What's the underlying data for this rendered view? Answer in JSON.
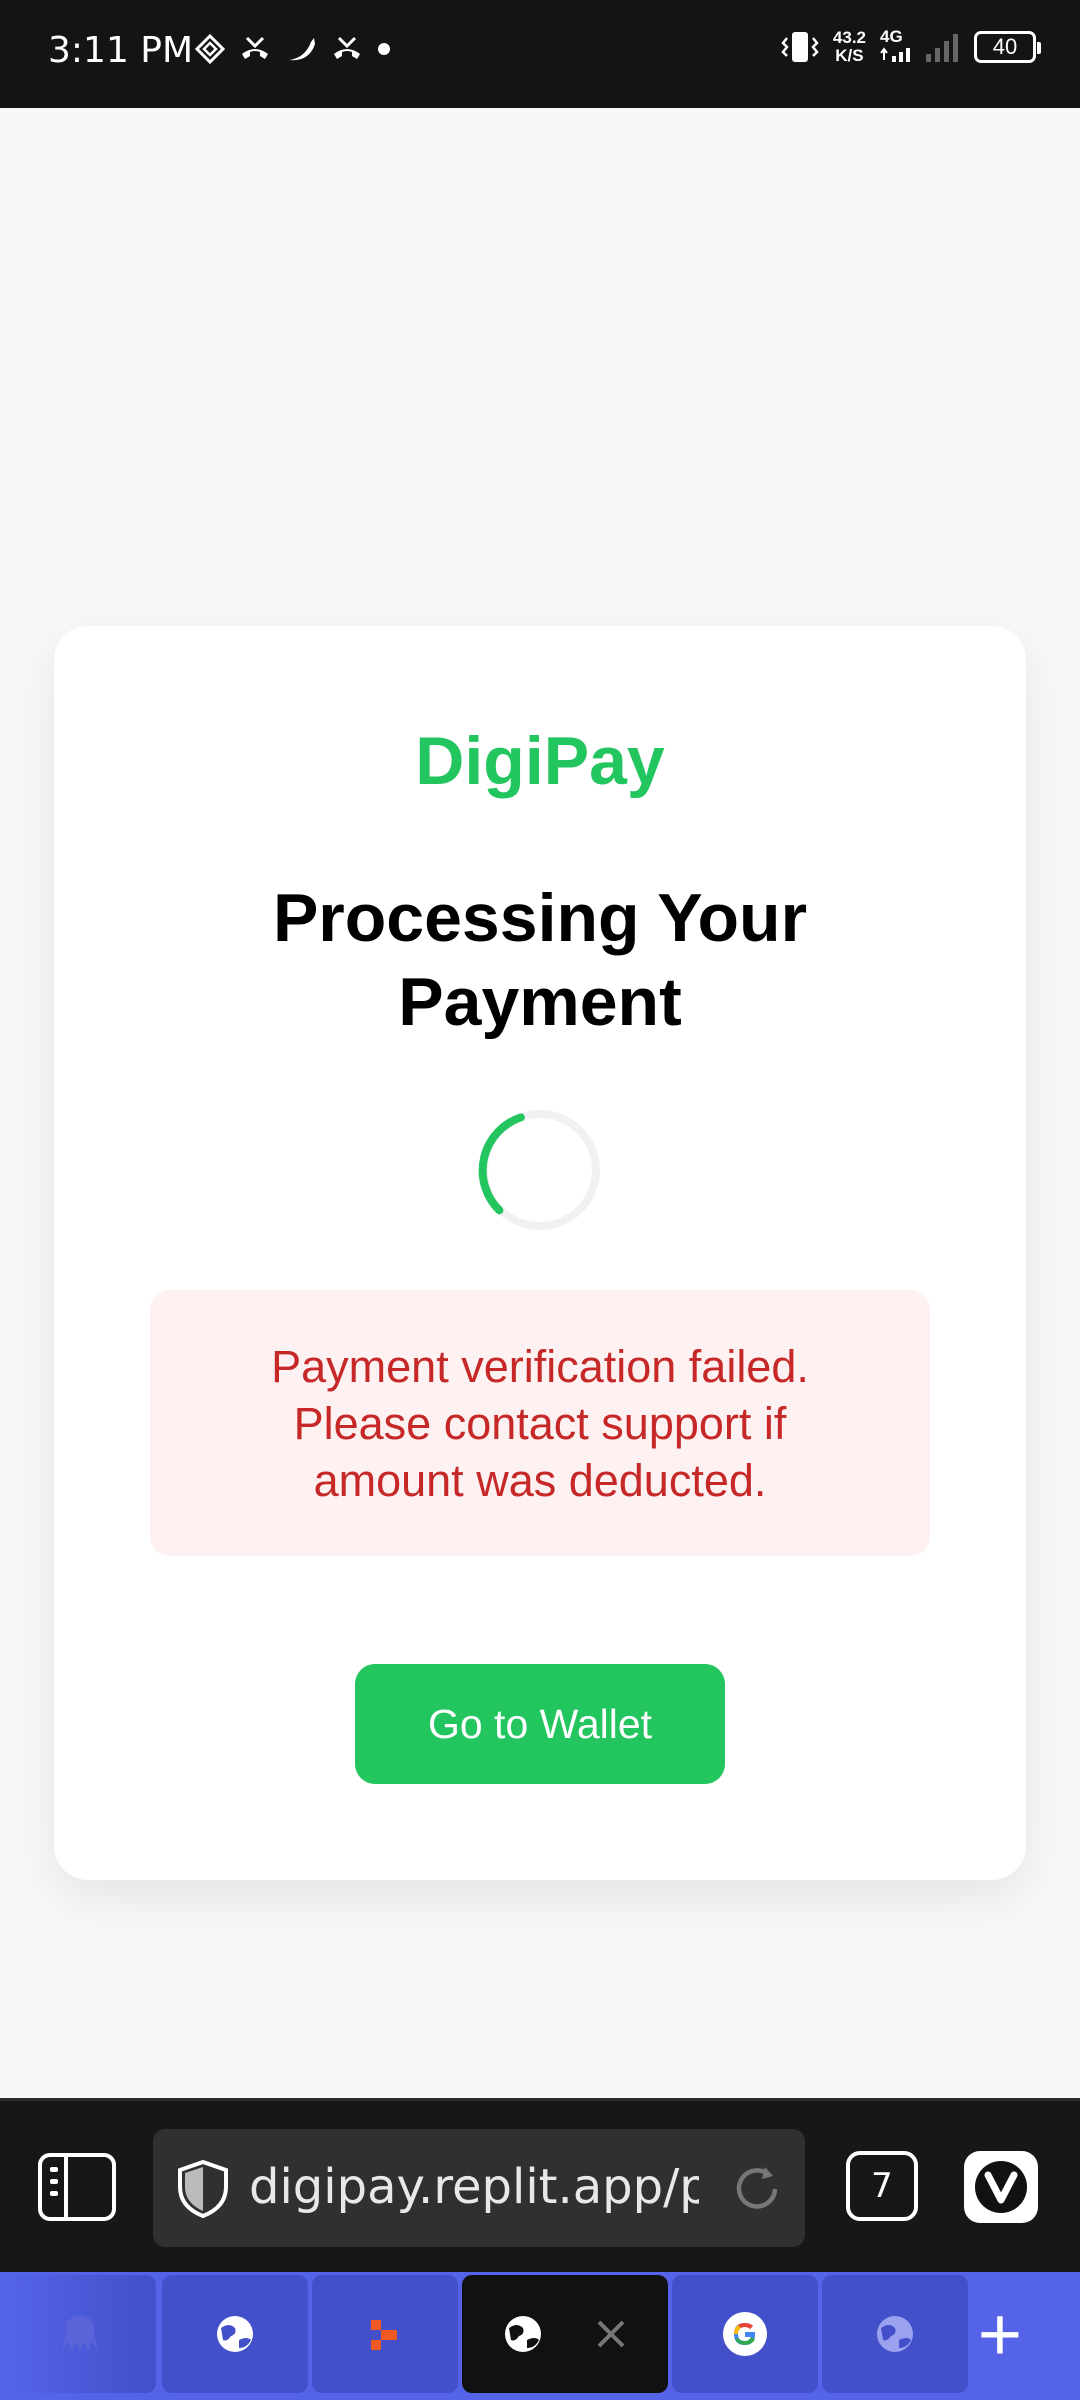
{
  "status_bar": {
    "time": "3:11 PM",
    "net_speed_value": "43.2",
    "net_speed_unit": "K/S",
    "network_type": "4G",
    "battery": "40"
  },
  "card": {
    "brand": "DigiPay",
    "title": "Processing Your Payment",
    "error_message": "Payment verification failed. Please contact support if amount was deducted.",
    "button_label": "Go to Wallet"
  },
  "browser": {
    "url": "digipay.replit.app/pay",
    "tab_count": "7"
  },
  "colors": {
    "accent": "#22c55e",
    "error_text": "#c62828",
    "error_bg": "#fef1f1",
    "tab_bar": "#5563e8"
  }
}
